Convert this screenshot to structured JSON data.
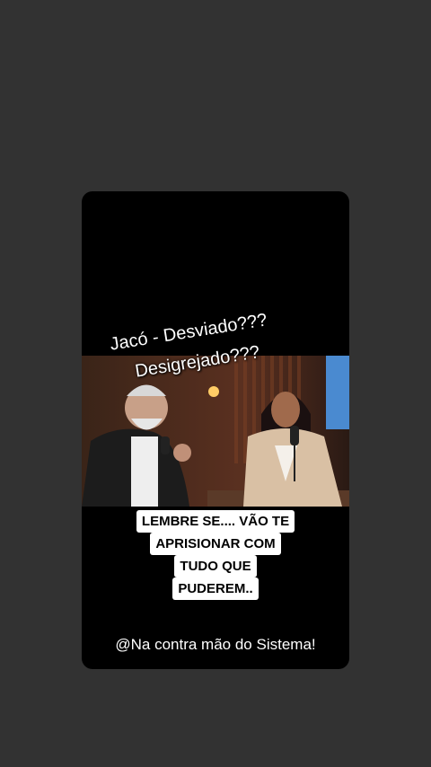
{
  "story": {
    "title_line_1": "Jacó - Desviado???",
    "title_line_2": "Desigrejado???",
    "caption_lines": [
      "LEMBRE SE.... VÃO TE",
      "APRISIONAR COM",
      "TUDO QUE",
      "PUDEREM.."
    ],
    "handle": "@Na contra mão do Sistema!",
    "photo_description_icon": "podcast-photo"
  },
  "colors": {
    "background": "#323232",
    "card": "#000000",
    "caption_bg": "#ffffff"
  }
}
